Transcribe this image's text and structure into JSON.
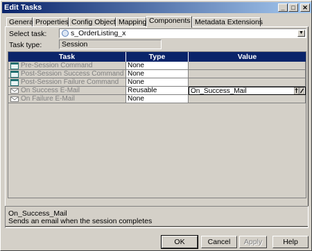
{
  "window": {
    "title": "Edit Tasks",
    "controls": {
      "minimize": "_",
      "maximize": "□",
      "close": "✕"
    }
  },
  "tabs": [
    {
      "label": "General",
      "active": false
    },
    {
      "label": "Properties",
      "active": false
    },
    {
      "label": "Config Object",
      "active": false
    },
    {
      "label": "Mapping",
      "active": false
    },
    {
      "label": "Components",
      "active": true
    },
    {
      "label": "Metadata Extensions",
      "active": false
    }
  ],
  "select_task": {
    "label": "Select task:",
    "value": "s_OrderListing_x"
  },
  "task_type": {
    "label": "Task type:",
    "value": "Session"
  },
  "grid": {
    "columns": [
      "Task",
      "Type",
      "Value"
    ],
    "rows": [
      {
        "task": "Pre-Session Command",
        "type": "None",
        "value": "",
        "icon": "command-icon"
      },
      {
        "task": "Post-Session Success Command",
        "type": "None",
        "value": "",
        "icon": "command-icon"
      },
      {
        "task": "Post-Session Failure Command",
        "type": "None",
        "value": "",
        "icon": "command-icon"
      },
      {
        "task": "On Success E-Mail",
        "type": "Reusable",
        "value": "On_Success_Mail",
        "icon": "email-icon",
        "editing": true
      },
      {
        "task": "On Failure E-Mail",
        "type": "None",
        "value": "",
        "icon": "email-icon"
      }
    ]
  },
  "description": {
    "title": "On_Success_Mail",
    "text": "Sends an email when the session completes"
  },
  "buttons": {
    "ok": "OK",
    "cancel": "Cancel",
    "apply": "Apply",
    "help": "Help"
  },
  "colors": {
    "title_bar_start": "#0a246a",
    "title_bar_end": "#a6caf0",
    "grid_header": "#0a246a",
    "window_face": "#d4d0c8"
  }
}
